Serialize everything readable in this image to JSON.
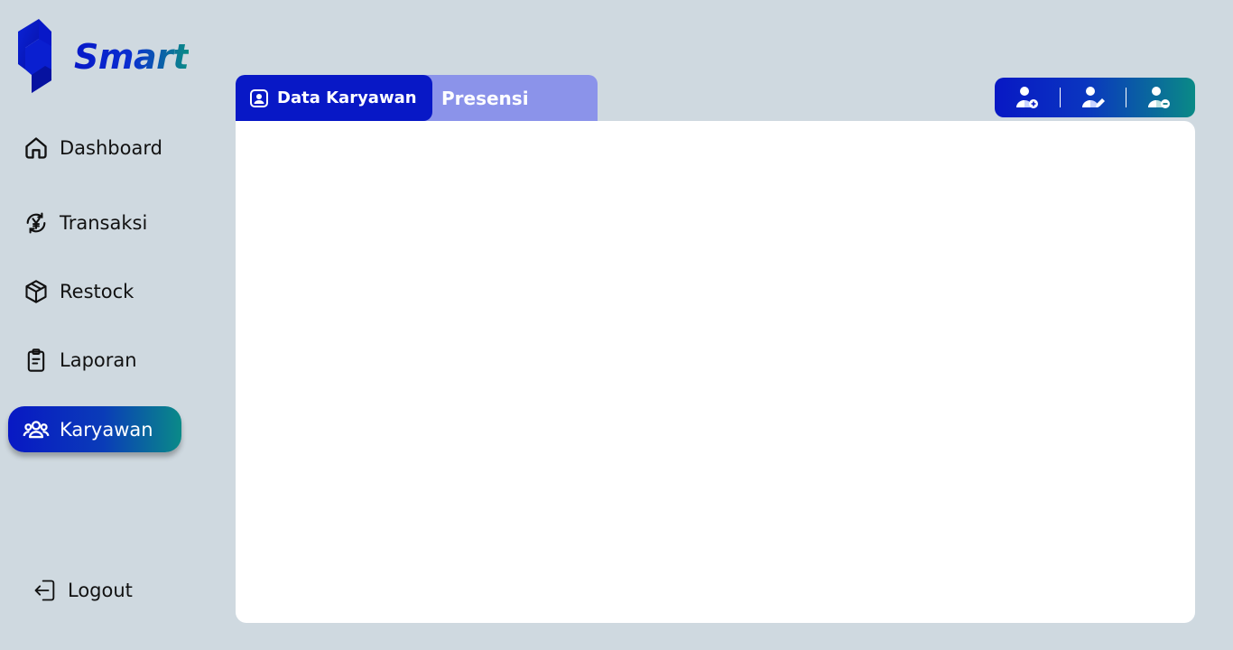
{
  "brand": {
    "name": "Smart"
  },
  "sidebar": {
    "items": [
      {
        "label": "Dashboard",
        "icon": "home-icon"
      },
      {
        "label": "Transaksi",
        "icon": "yen-exchange-icon"
      },
      {
        "label": "Restock",
        "icon": "box-icon"
      },
      {
        "label": "Laporan",
        "icon": "clipboard-icon"
      },
      {
        "label": "Karyawan",
        "icon": "users-icon",
        "active": true
      }
    ],
    "logout": {
      "label": "Logout",
      "icon": "logout-icon"
    }
  },
  "tabs": [
    {
      "label": "Data Karyawan",
      "icon": "id-badge-icon",
      "active": true
    },
    {
      "label": "Presensi",
      "active": false
    }
  ],
  "actions": [
    {
      "icon": "user-add-icon"
    },
    {
      "icon": "user-edit-icon"
    },
    {
      "icon": "user-remove-icon"
    }
  ],
  "colors": {
    "background": "#CFD9E0",
    "primary": "#0818C6",
    "accent_teal": "#0A8A86",
    "tab_inactive": "#8B93EA",
    "panel": "#FFFFFF"
  }
}
